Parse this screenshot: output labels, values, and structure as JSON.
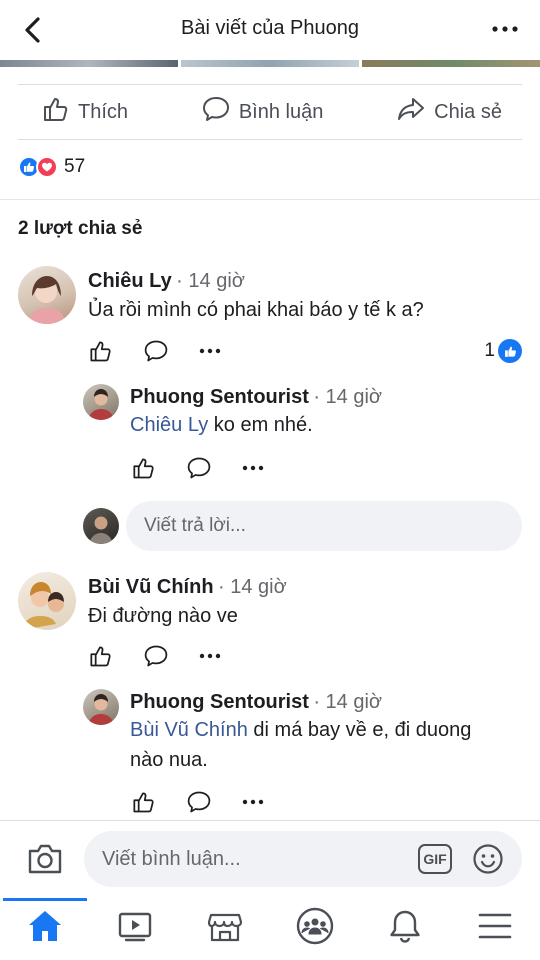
{
  "header": {
    "title": "Bài viết của Phuong"
  },
  "actions": {
    "like": "Thích",
    "comment": "Bình luận",
    "share": "Chia sẻ"
  },
  "reactions": {
    "count": "57"
  },
  "shares": "2 lượt chia sẻ",
  "comments": [
    {
      "name": "Chiêu Ly",
      "time": "· 14 giờ",
      "text": "Ủa rồi mình có phai khai báo y tế k a?",
      "like_count": "1",
      "replies": [
        {
          "name": "Phuong Sentourist",
          "time": "· 14 giờ",
          "mention": "Chiêu Ly",
          "text": " ko em nhé."
        }
      ]
    },
    {
      "name": "Bùi Vũ Chính",
      "time": "· 14 giờ",
      "text": "Đi đường nào ve",
      "replies": [
        {
          "name": "Phuong Sentourist",
          "time": "· 14 giờ",
          "mention": "Bùi Vũ Chính",
          "text": " di má bay về e, đi duong nào nua."
        }
      ]
    }
  ],
  "reply_placeholder": "Viết trả lời...",
  "comment_placeholder": "Viết bình luận...",
  "gif_label": "GIF",
  "colors": {
    "accent": "#1877f2",
    "mention": "#385898",
    "input_bg": "#f0f2f5"
  }
}
